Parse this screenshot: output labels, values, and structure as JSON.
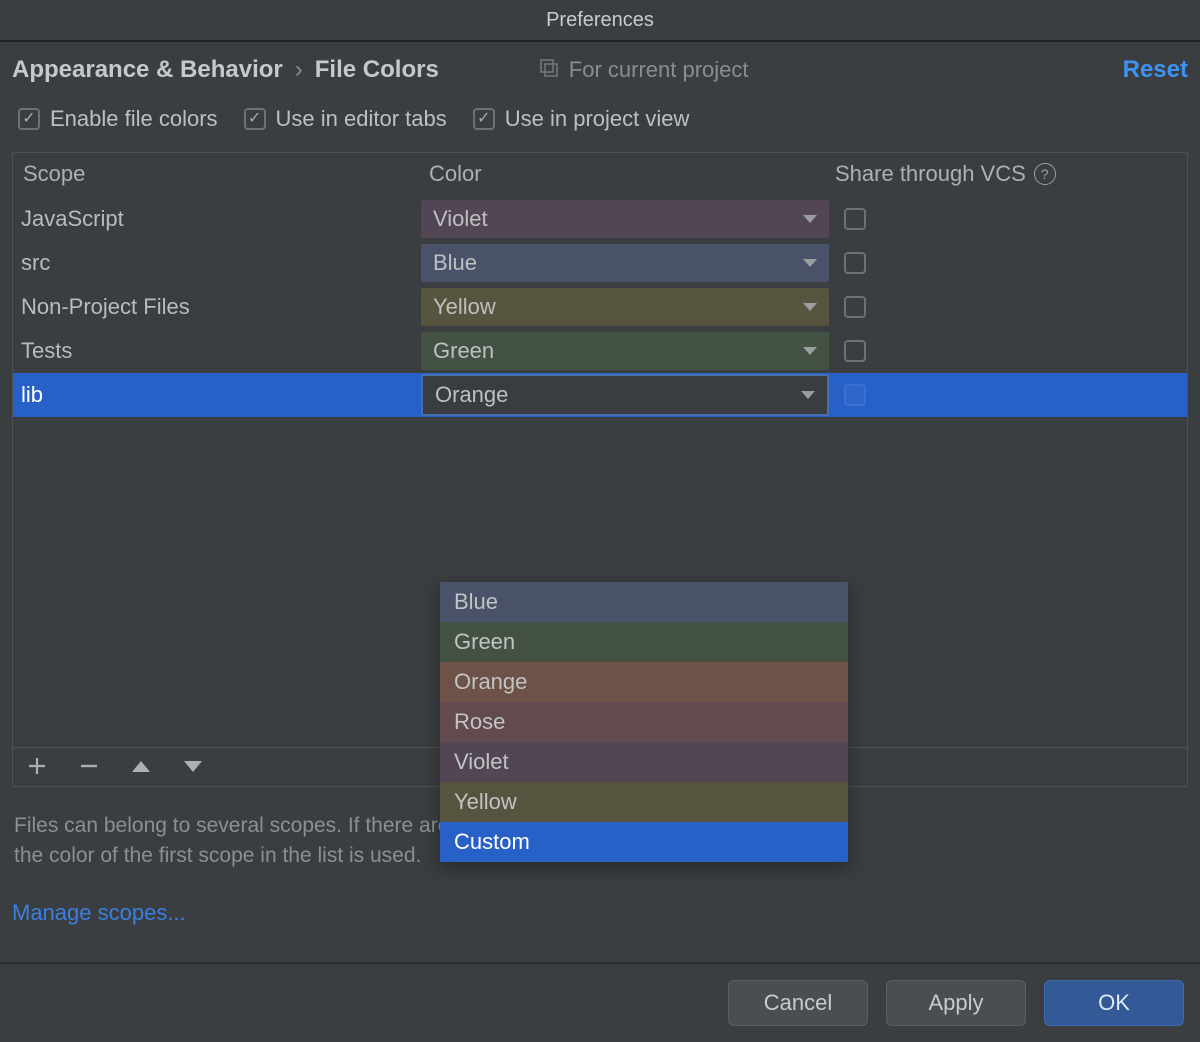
{
  "title": "Preferences",
  "breadcrumb": {
    "parent": "Appearance & Behavior",
    "current": "File Colors"
  },
  "for_project_label": "For current project",
  "reset_label": "Reset",
  "options": {
    "enable": "Enable file colors",
    "editor_tabs": "Use in editor tabs",
    "project_view": "Use in project view"
  },
  "table": {
    "headers": {
      "scope": "Scope",
      "color": "Color",
      "share": "Share through VCS"
    },
    "rows": [
      {
        "scope": "JavaScript",
        "color": "Violet",
        "swatch": "c-violet",
        "share": false,
        "selected": false
      },
      {
        "scope": "src",
        "color": "Blue",
        "swatch": "c-blue",
        "share": false,
        "selected": false
      },
      {
        "scope": "Non-Project Files",
        "color": "Yellow",
        "swatch": "c-yellow",
        "share": false,
        "selected": false
      },
      {
        "scope": "Tests",
        "color": "Green",
        "swatch": "c-green",
        "share": false,
        "selected": false
      },
      {
        "scope": "lib",
        "color": "Orange",
        "swatch": "",
        "share": false,
        "selected": true
      }
    ]
  },
  "dropdown": {
    "items": [
      {
        "label": "Blue",
        "swatch": "c-blue",
        "selected": false
      },
      {
        "label": "Green",
        "swatch": "c-green",
        "selected": false
      },
      {
        "label": "Orange",
        "swatch": "c-orange",
        "selected": false
      },
      {
        "label": "Rose",
        "swatch": "c-rose",
        "selected": false
      },
      {
        "label": "Violet",
        "swatch": "c-violet",
        "selected": false
      },
      {
        "label": "Yellow",
        "swatch": "c-yellow",
        "selected": false
      },
      {
        "label": "Custom",
        "swatch": "",
        "selected": true
      }
    ]
  },
  "hint": "Files can belong to several scopes. If there are two colors for one scope, the color of the first scope in the list is used.",
  "manage_scopes": "Manage scopes...",
  "buttons": {
    "cancel": "Cancel",
    "apply": "Apply",
    "ok": "OK"
  }
}
